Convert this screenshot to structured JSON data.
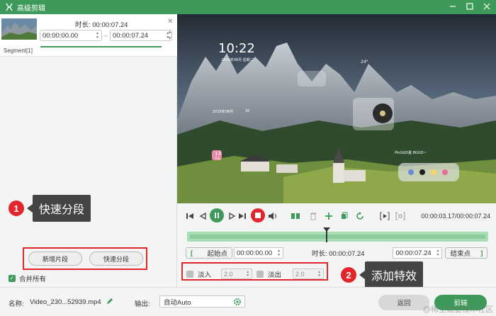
{
  "window": {
    "title": "高级剪辑"
  },
  "segment": {
    "duration_label": "时长: 00:00:07.24",
    "start_time": "00:00:00.00",
    "end_time": "00:00:07.24",
    "label": "Segment[1]"
  },
  "left_buttons": {
    "add_segment": "新增片段",
    "quick_split": "快速分段"
  },
  "merge_all": {
    "label": "合并所有",
    "checked": true
  },
  "annotations": [
    {
      "num": "1",
      "text": "快速分段"
    },
    {
      "num": "2",
      "text": "添加特效"
    }
  ],
  "video": {
    "clock": "10:22",
    "date_line": "2019年08月 星期二",
    "calendar_title": "2019年08月",
    "calendar_head": "30",
    "calendar_today": "13",
    "calendar_today_label": "今天",
    "weather": "24°",
    "music_label": "PinGGD夏 BGGD~"
  },
  "player": {
    "time": "00:00:03.17/00:00:07.24"
  },
  "trim": {
    "start_label": "起始点",
    "start_time": "00:00:00.00",
    "duration_label": "时长: 00:00:07.24",
    "end_time": "00:00:07.24",
    "end_label": "结束点"
  },
  "effects": {
    "fade_in_label": "淡入",
    "fade_in_value": "2.0",
    "fade_out_label": "淡出",
    "fade_out_value": "2.0"
  },
  "bottom": {
    "name_label": "名称:",
    "file_name": "Video_230...52939.mp4",
    "output_label": "输出:",
    "output_value": "自动Auto",
    "back_button": "返回",
    "cut_button": "剪辑",
    "watermark": "@稀土掘金技术社区"
  },
  "colors": {
    "accent": "#3d9a5b",
    "annotation_red": "#e2262b",
    "callout_bg": "#444444"
  }
}
